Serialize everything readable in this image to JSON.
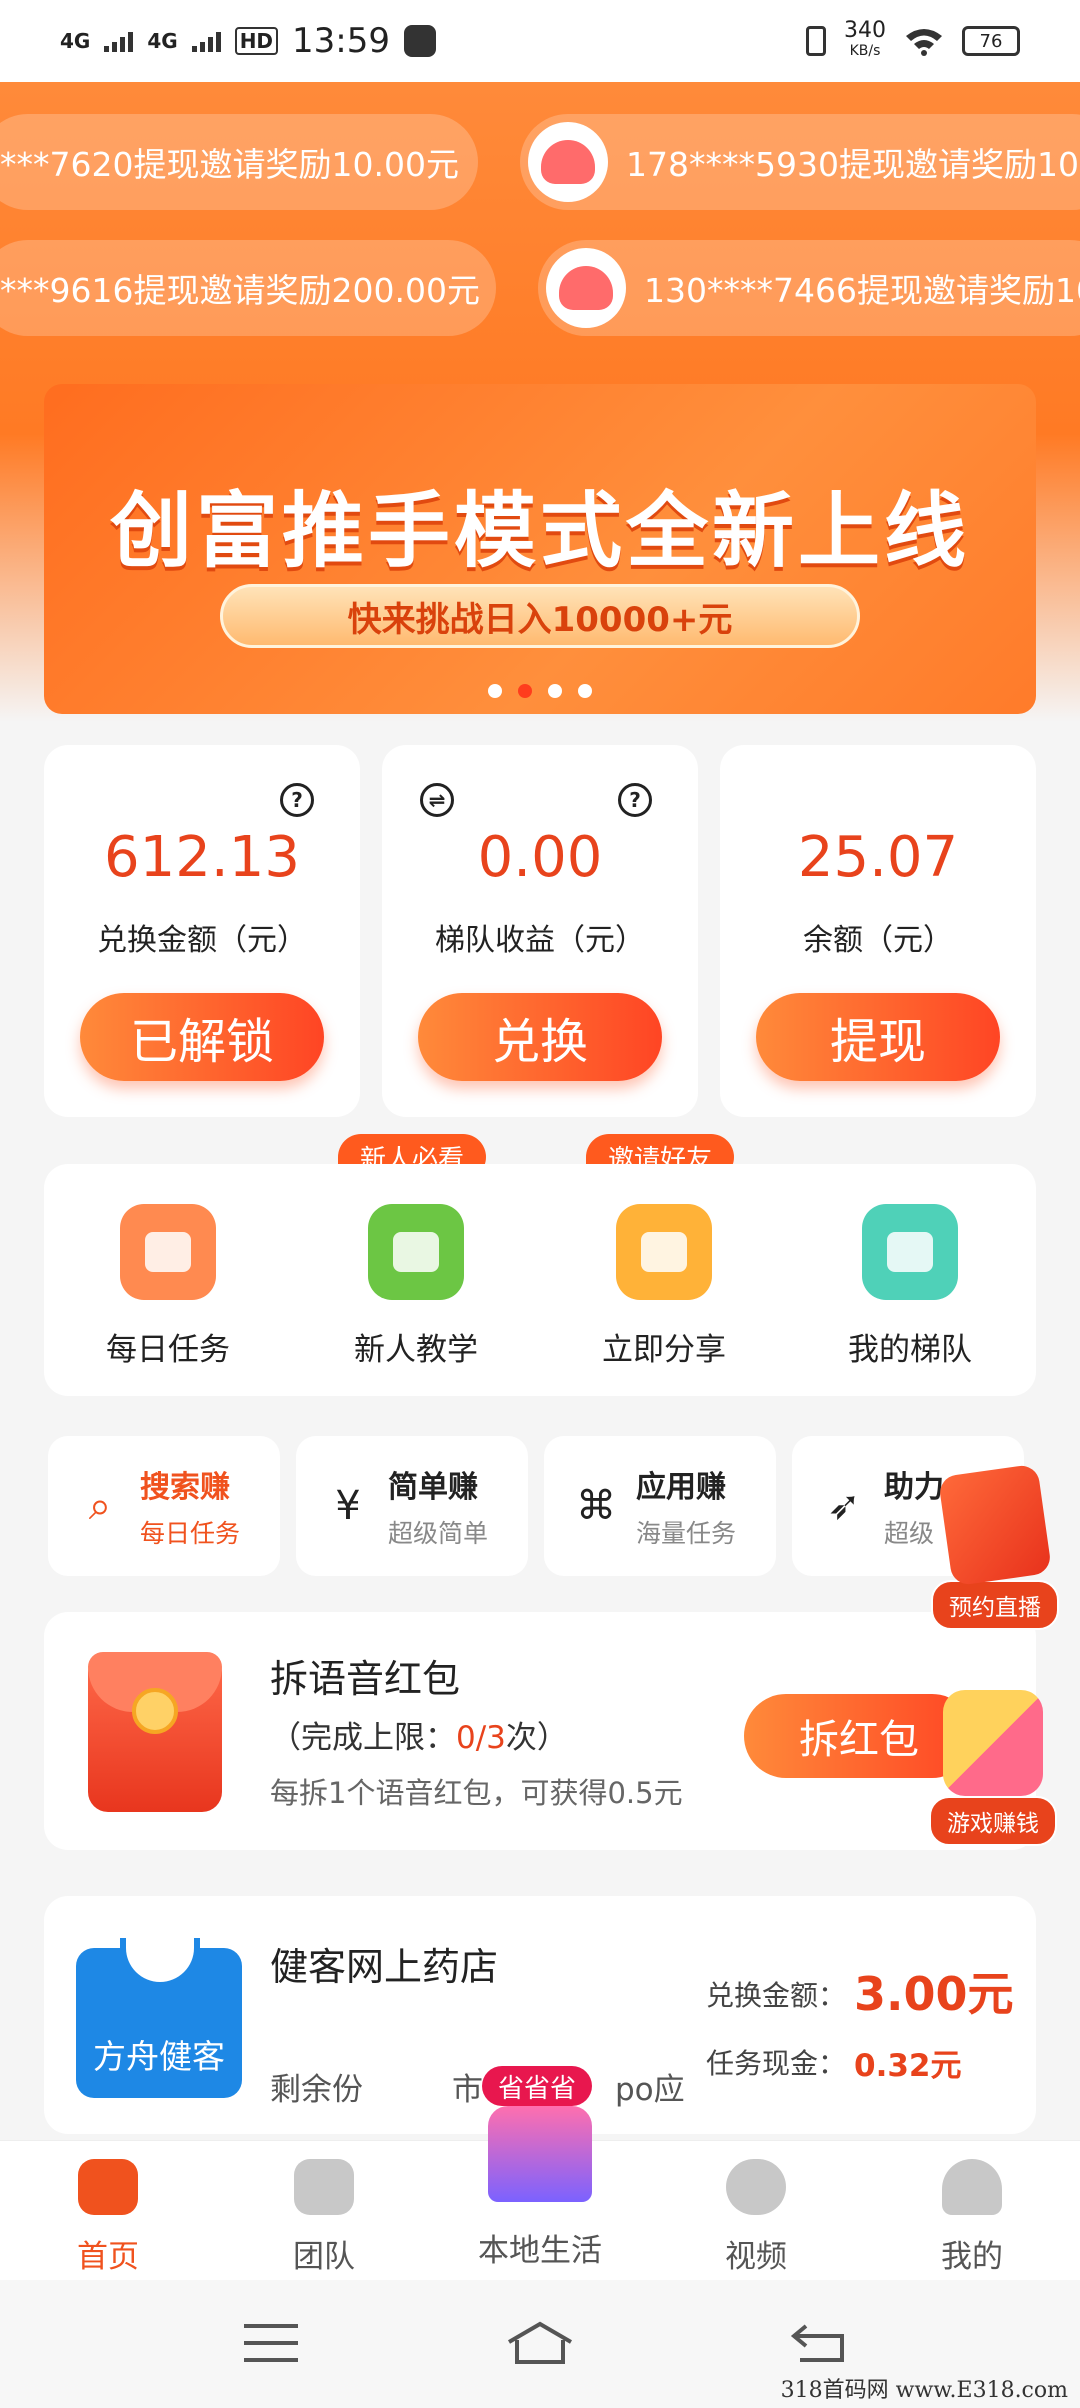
{
  "status_bar": {
    "network_1": "4G",
    "network_2": "4G",
    "hd": "HD",
    "time": "13:59",
    "speed_value": "340",
    "speed_unit": "KB/s",
    "battery": "76"
  },
  "ticker": [
    {
      "text": "***7620提现邀请奖励10.00元"
    },
    {
      "text": "178****5930提现邀请奖励10.0"
    },
    {
      "text": "***9616提现邀请奖励200.00元"
    },
    {
      "text": "130****7466提现邀请奖励10."
    }
  ],
  "banner": {
    "title": "创富推手模式全新上线",
    "subtitle": "快来挑战日入10000+元",
    "active_dot": 2
  },
  "stats": [
    {
      "value": "612.13",
      "label": "兑换金额（元）",
      "button": "已解锁"
    },
    {
      "value": "0.00",
      "label": "梯队收益（元）",
      "button": "兑换"
    },
    {
      "value": "25.07",
      "label": "余额（元）",
      "button": "提现"
    }
  ],
  "quick_actions": [
    {
      "label": "每日任务",
      "icon": "play-icon",
      "color": "#ff8a50"
    },
    {
      "label": "新人教学",
      "icon": "book-icon",
      "color": "#6cc644",
      "tag": "新人必看"
    },
    {
      "label": "立即分享",
      "icon": "image-icon",
      "color": "#ffb238",
      "tag": "邀请好友"
    },
    {
      "label": "我的梯队",
      "icon": "person-icon",
      "color": "#4fd1b8"
    }
  ],
  "earn_tabs": [
    {
      "title": "搜索赚",
      "sub": "每日任务",
      "icon": "search-icon"
    },
    {
      "title": "简单赚",
      "sub": "超级简单",
      "icon": "yen-icon"
    },
    {
      "title": "应用赚",
      "sub": "海量任务",
      "icon": "apps-icon"
    },
    {
      "title": "助力",
      "sub": "超级",
      "icon": "rocket-icon"
    }
  ],
  "red_packet": {
    "title": "拆语音红包",
    "limit_prefix": "（完成上限：",
    "limit_value": "0/3",
    "limit_suffix": "次）",
    "desc": "每拆1个语音红包，可获得0.5元",
    "button": "拆红包"
  },
  "pharmacy": {
    "logo_text": "方舟健客",
    "title": "健客网上药店",
    "remaining": "剩余份",
    "market": "市",
    "market_tail": "po应",
    "exchange_label": "兑换金额：",
    "exchange_value": "3.00元",
    "cash_label": "任务现金：",
    "cash_value": "0.32元"
  },
  "floating": {
    "live": "预约直播",
    "game": "游戏赚钱"
  },
  "nav": {
    "items": [
      {
        "label": "首页",
        "icon": "home-icon"
      },
      {
        "label": "团队",
        "icon": "team-icon"
      },
      {
        "label": "本地生活",
        "icon": "shop-icon"
      },
      {
        "label": "视频",
        "icon": "video-icon"
      },
      {
        "label": "我的",
        "icon": "profile-icon"
      }
    ],
    "center_badge": "省省省"
  },
  "watermark": "318首码网 www.E318.com"
}
